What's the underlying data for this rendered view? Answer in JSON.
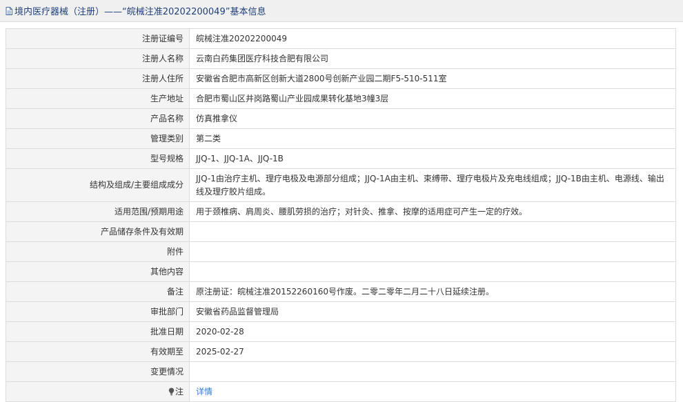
{
  "header": {
    "icon": "document-icon",
    "title": "境内医疗器械（注册）——“皖械注准20202200049”基本信息"
  },
  "rows": [
    {
      "label": "注册证编号",
      "value": "皖械注准20202200049"
    },
    {
      "label": "注册人名称",
      "value": "云南白药集团医疗科技合肥有限公司"
    },
    {
      "label": "注册人住所",
      "value": "安徽省合肥市高新区创新大道2800号创新产业园二期F5-510-511室"
    },
    {
      "label": "生产地址",
      "value": "合肥市蜀山区井岗路蜀山产业园成果转化基地3幢3层"
    },
    {
      "label": "产品名称",
      "value": "仿真推拿仪"
    },
    {
      "label": "管理类别",
      "value": "第二类"
    },
    {
      "label": "型号规格",
      "value": "JJQ-1、JJQ-1A、JJQ-1B"
    },
    {
      "label": "结构及组成/主要组成成分",
      "value": "JJQ-1由治疗主机、理疗电极及电源部分组成；JJQ-1A由主机、束缚带、理疗电极片及充电线组成；JJQ-1B由主机、电源线、输出线及理疗胶片组成。"
    },
    {
      "label": "适用范围/预期用途",
      "value": "用于颈椎病、肩周炎、腰肌劳损的治疗；对针灸、推拿、按摩的适用症可产生一定的疗效。"
    },
    {
      "label": "产品储存条件及有效期",
      "value": ""
    },
    {
      "label": "附件",
      "value": ""
    },
    {
      "label": "其他内容",
      "value": ""
    },
    {
      "label": "备注",
      "value": "原注册证：皖械注准20152260160号作废。二零二零年二月二十八日延续注册。"
    },
    {
      "label": "审批部门",
      "value": "安徽省药品监督管理局"
    },
    {
      "label": "批准日期",
      "value": "2020-02-28"
    },
    {
      "label": "有效期至",
      "value": "2025-02-27"
    },
    {
      "label": "变更情况",
      "value": ""
    }
  ],
  "note": {
    "icon": "lightbulb-icon",
    "label": "注",
    "link_text": "详情"
  },
  "colors": {
    "title_text": "#1f3f7a",
    "label_bg": "#f4f4f4",
    "border": "#dcdcdc",
    "link": "#2f7bd6"
  }
}
